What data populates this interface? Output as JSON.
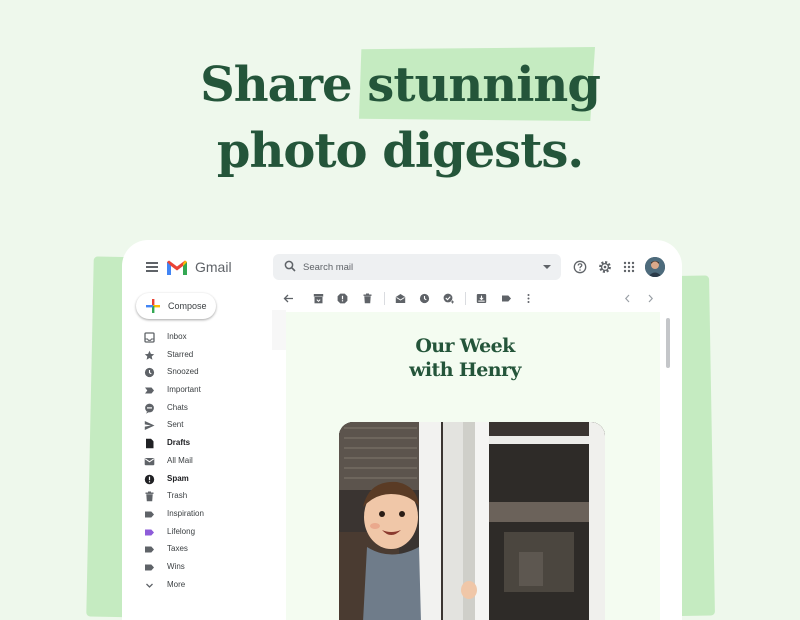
{
  "headline": {
    "line1_plain": "Share ",
    "line1_highlight": "stunning",
    "line2": "photo digests."
  },
  "gmail": {
    "app_name": "Gmail",
    "search": {
      "placeholder": "Search mail"
    },
    "compose_label": "Compose",
    "sidebar": {
      "items": [
        {
          "label": "Inbox",
          "icon": "inbox-icon",
          "bold": false
        },
        {
          "label": "Starred",
          "icon": "star-icon",
          "bold": false
        },
        {
          "label": "Snoozed",
          "icon": "clock-icon",
          "bold": false
        },
        {
          "label": "Important",
          "icon": "important-icon",
          "bold": false
        },
        {
          "label": "Chats",
          "icon": "chat-icon",
          "bold": false
        },
        {
          "label": "Sent",
          "icon": "send-icon",
          "bold": false
        },
        {
          "label": "Drafts",
          "icon": "draft-icon",
          "bold": true
        },
        {
          "label": "All Mail",
          "icon": "mail-icon",
          "bold": false
        },
        {
          "label": "Spam",
          "icon": "spam-icon",
          "bold": true
        },
        {
          "label": "Trash",
          "icon": "trash-icon",
          "bold": false
        },
        {
          "label": "Inspiration",
          "icon": "label-icon",
          "bold": false
        },
        {
          "label": "Lifelong",
          "icon": "label-icon",
          "bold": false,
          "color": "#8e5cd9"
        },
        {
          "label": "Taxes",
          "icon": "label-icon",
          "bold": false
        },
        {
          "label": "Wins",
          "icon": "label-icon",
          "bold": false
        },
        {
          "label": "More",
          "icon": "chevron-down-icon",
          "bold": false
        }
      ]
    },
    "message": {
      "title_line1": "Our Week",
      "title_line2": "with Henry"
    }
  },
  "colors": {
    "page_bg": "#eef8ec",
    "headline": "#24553a",
    "highlight": "#c5ebc1",
    "message_bg": "#f4fcf1"
  }
}
